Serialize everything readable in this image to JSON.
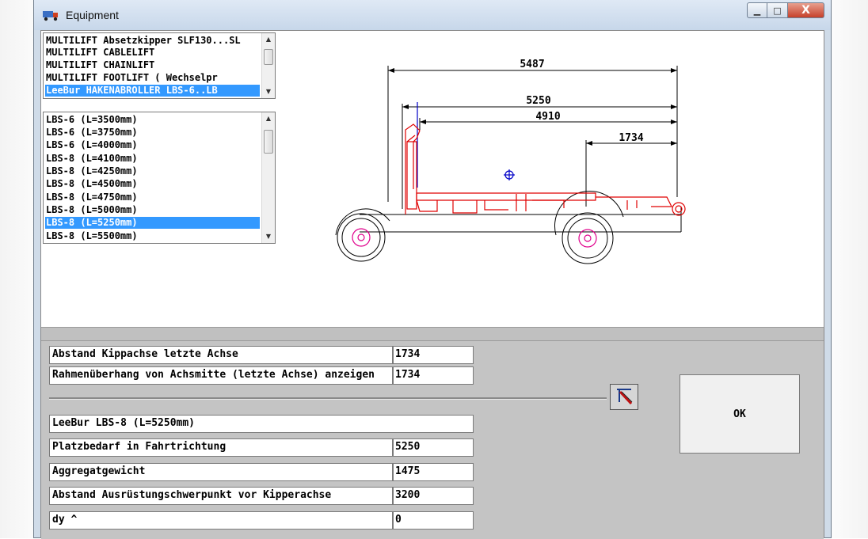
{
  "window": {
    "title": "Equipment",
    "min_symbol": "▁",
    "max_symbol": "□",
    "close_symbol": "X"
  },
  "equipment_list": {
    "items": [
      "MULTILIFT Absetzkipper SLF130...SL",
      "MULTILIFT CABLELIFT",
      "MULTILIFT CHAINLIFT",
      "MULTILIFT FOOTLIFT    ( Wechselpr",
      "LeeBur HAKENABROLLER LBS-6..LB"
    ],
    "selected_index": 4
  },
  "variant_list": {
    "items": [
      "LBS-6 (L=3500mm)",
      "LBS-6 (L=3750mm)",
      "LBS-6 (L=4000mm)",
      "LBS-8 (L=4100mm)",
      "LBS-8 (L=4250mm)",
      "LBS-8 (L=4500mm)",
      "LBS-8 (L=4750mm)",
      "LBS-8 (L=5000mm)",
      "LBS-8 (L=5250mm)",
      "LBS-8 (L=5500mm)"
    ],
    "selected_index": 8
  },
  "drawing": {
    "dim_total": "5487",
    "dim_length": "5250",
    "dim_body": "4910",
    "dim_overhang": "1734",
    "colors": {
      "frame": "#e00000",
      "dims": "#000000",
      "wheel_center": "#e0008c",
      "cog": "#0000c8"
    }
  },
  "params": {
    "abstand_label": "Abstand Kippachse letzte Achse",
    "abstand_value": "1734",
    "rahmen_label": "Rahmenüberhang von Achsmitte (letzte Achse) anzeigen",
    "rahmen_value": "1734",
    "equipment_name": "LeeBur   LBS-8 (L=5250mm)",
    "platz_label": "Platzbedarf in Fahrtrichtung",
    "platz_value": "5250",
    "gewicht_label": "Aggregatgewicht",
    "gewicht_value": "1475",
    "schwer_label": "Abstand Ausrüstungschwerpunkt vor Kipperachse",
    "schwer_value": "3200",
    "dy_label": "dy ^",
    "dy_value": "0"
  },
  "ok_label": "OK"
}
